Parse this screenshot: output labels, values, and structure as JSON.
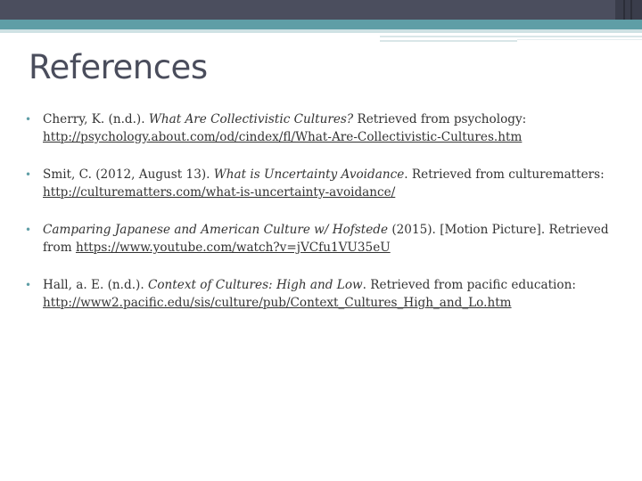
{
  "title": "References",
  "references": [
    {
      "prefix": "Cherry, K. (n.d.). ",
      "italic": "What Are Collectivistic Cultures?",
      "suffix": " Retrieved from psychology:",
      "url": "http://psychology.about.com/od/cindex/fl/What-Are-Collectivistic-Cultures.htm"
    },
    {
      "prefix": "Smit, C. (2012, August 13). ",
      "italic": "What is Uncertainty Avoidance",
      "suffix": ". Retrieved from culturematters:",
      "url": "http://culturematters.com/what-is-uncertainty-avoidance/"
    },
    {
      "prefix": "",
      "italic": "Camparing Japanese and American Culture w/ Hofstede",
      "suffix": " (2015). [Motion Picture]. Retrieved from ",
      "url": "https://www.youtube.com/watch?v=jVCfu1VU35eU"
    },
    {
      "prefix": "Hall, a. E. (n.d.). ",
      "italic": "Context of Cultures: High and Low",
      "suffix": ". Retrieved from pacific education:",
      "url": "http://www2.pacific.edu/sis/culture/pub/Context_Cultures_High_and_Lo.htm"
    }
  ]
}
